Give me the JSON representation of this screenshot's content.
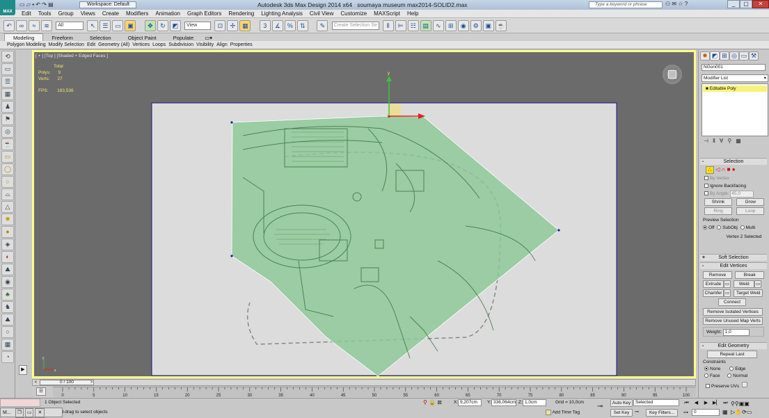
{
  "titlebar": {
    "logo": "MAX",
    "workspace": "Workspace: Default",
    "app_title": "Autodesk 3ds Max Design 2014 x64",
    "file_title": "soumaya museum max2014-SOLID2.max",
    "search_placeholder": "Type a keyword or phrase"
  },
  "menu": [
    "Edit",
    "Tools",
    "Group",
    "Views",
    "Create",
    "Modifiers",
    "Animation",
    "Graph Editors",
    "Rendering",
    "Lighting Analysis",
    "Civil View",
    "Customize",
    "MAXScript",
    "Help"
  ],
  "toolbar": {
    "filter_value": "All",
    "refcoord_value": "View",
    "selection_set_placeholder": "Create Selection Se"
  },
  "ribbon": {
    "tabs": [
      "Modeling",
      "Freeform",
      "Selection",
      "Object Paint",
      "Populate"
    ],
    "active_tab": "Modeling",
    "sub": [
      "Polygon Modeling",
      "Modify Selection",
      "Edit",
      "Geometry (All)",
      "Vertices",
      "Loops",
      "Subdivision",
      "Visibility",
      "Align",
      "Properties"
    ]
  },
  "viewport": {
    "label": "[ + ] [Top ] [Shaded + Edged Faces ]",
    "stats": {
      "total_label": "Total",
      "polys_label": "Polys:",
      "polys_value": "9",
      "verts_label": "Verts:",
      "verts_value": "27",
      "fps_label": "FPS:",
      "fps_value": "183,536"
    },
    "colors": {
      "background": "#6b6b6b",
      "plane": "#dcdcdc",
      "poly_fill": "#8cc896",
      "border_active": "#fdfd8a"
    }
  },
  "command_panel": {
    "object_name": "NGon001",
    "modifier_list": "Modifier List",
    "stack_item": "Editable Poly",
    "selection": {
      "title": "Selection",
      "by_vertex": "By Vertex",
      "ignore_backfacing": "Ignore Backfacing",
      "by_angle": "By Angle:",
      "by_angle_value": "45,0",
      "shrink": "Shrink",
      "grow": "Grow",
      "ring": "Ring",
      "loop": "Loop",
      "preview_title": "Preview Selection",
      "preview_off": "Off",
      "preview_subobj": "SubObj",
      "preview_multi": "Multi",
      "status": "Vertex 2 Selected"
    },
    "soft_selection": "Soft Selection",
    "edit_vertices": {
      "title": "Edit Vertices",
      "remove": "Remove",
      "break": "Break",
      "extrude": "Extrude",
      "weld": "Weld",
      "chamfer": "Chamfer",
      "target_weld": "Target Weld",
      "connect": "Connect",
      "remove_isolated": "Remove Isolated Vertices",
      "remove_unused": "Remove Unused Map Verts",
      "weight_label": "Weight:",
      "weight_value": "1,0"
    },
    "edit_geometry": {
      "title": "Edit Geometry",
      "repeat_last": "Repeat Last",
      "constraints": "Constraints",
      "none": "None",
      "edge": "Edge",
      "face": "Face",
      "normal": "Normal",
      "preserve_uvs": "Preserve UVs"
    }
  },
  "timeline": {
    "frame_display": "0 / 100",
    "ticks": [
      "0",
      "5",
      "10",
      "15",
      "20",
      "25",
      "30",
      "35",
      "40",
      "45",
      "50",
      "55",
      "60",
      "65",
      "70",
      "75",
      "80",
      "85",
      "90",
      "95",
      "100"
    ]
  },
  "status": {
    "selected": "1 Object Selected",
    "prompt": "Click-and-drag to select objects",
    "taskbar_label": "M...",
    "x_label": "X:",
    "x_value": "9,207cm",
    "y_label": "Y:",
    "y_value": "336,064cm",
    "z_label": "Z:",
    "z_value": "1,0cm",
    "grid": "Grid = 10,0cm",
    "add_time_tag": "Add Time Tag",
    "auto_key": "Auto Key",
    "set_key": "Set Key",
    "selected_dropdown": "Selected",
    "key_filters": "Key Filters...",
    "frame_value": "0"
  }
}
